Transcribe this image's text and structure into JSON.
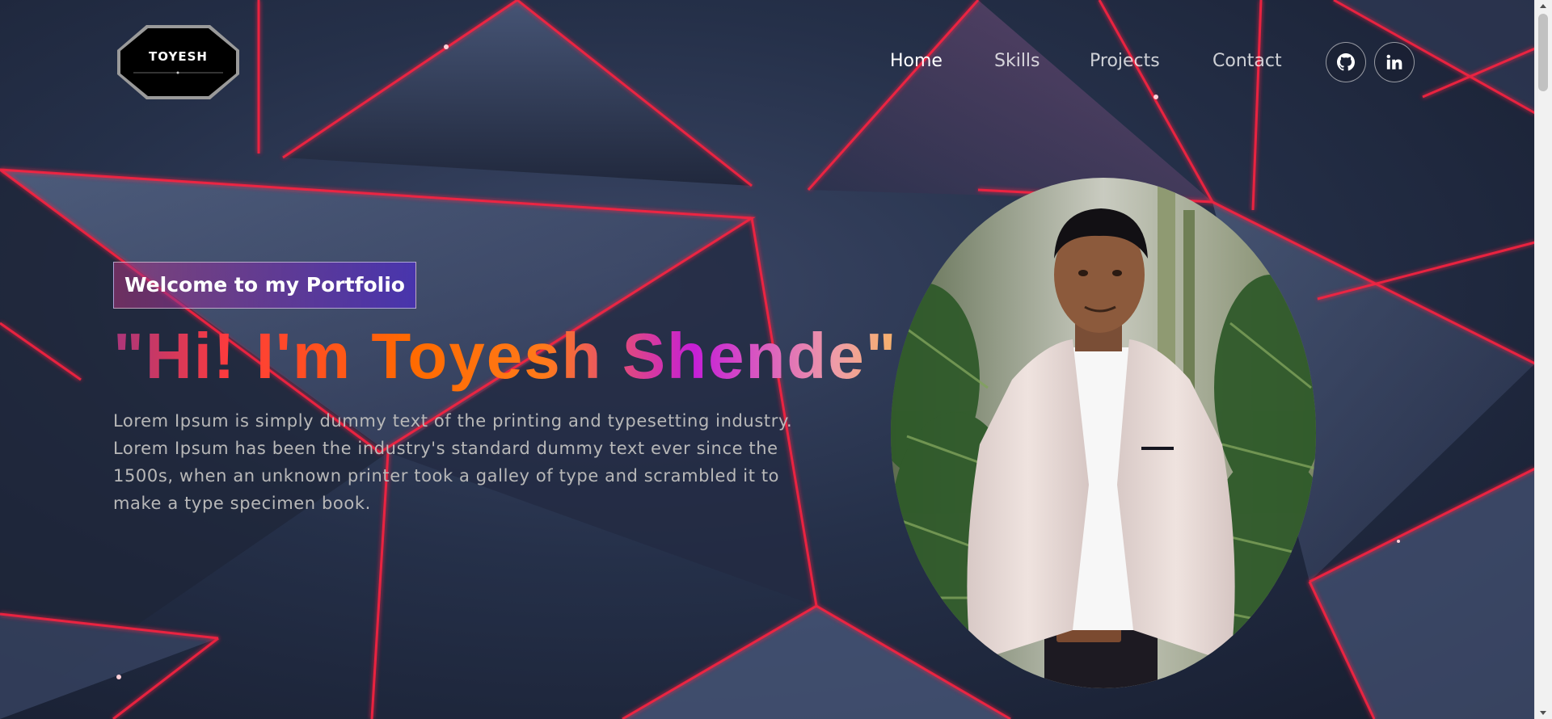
{
  "logo": {
    "text": "TOYESH",
    "alt": "Toyesh logo"
  },
  "nav": {
    "links": [
      {
        "label": "Home",
        "active": true
      },
      {
        "label": "Skills",
        "active": false
      },
      {
        "label": "Projects",
        "active": false
      },
      {
        "label": "Contact",
        "active": false
      }
    ],
    "social": [
      {
        "icon": "github-icon"
      },
      {
        "icon": "linkedin-icon"
      }
    ]
  },
  "hero": {
    "tagline": "Welcome to my Portfolio",
    "title": "\"Hi! I'm Toyesh Shende\"",
    "description": "Lorem Ipsum is simply dummy text of the printing and typesetting industry. Lorem Ipsum has been the industry's standard dummy text ever since the 1500s, when an unknown printer took a galley of type and scrambled it to make a type specimen book."
  },
  "colors": {
    "accent_pink": "#aa367c",
    "accent_purple": "#4a2fbd",
    "neon_red": "#ff2340",
    "background": "#1b2338"
  }
}
